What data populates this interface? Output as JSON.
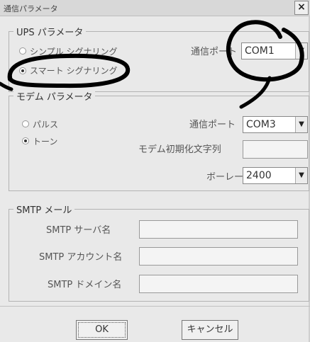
{
  "window": {
    "title": "通信パラメータ",
    "close_label": "×"
  },
  "ups": {
    "legend": "UPS パラメータ",
    "radio_simple": "シンプル シグナリング",
    "radio_smart": "スマート シグナリング",
    "port_label": "通信ポート",
    "port_value": "COM1"
  },
  "modem": {
    "legend": "モデム パラメータ",
    "radio_pulse": "パルス",
    "radio_tone": "トーン",
    "port_label": "通信ポート",
    "port_value": "COM3",
    "init_label": "モデム初期化文字列",
    "init_value": "",
    "baud_label": "ボーレート",
    "baud_value": "2400"
  },
  "smtp": {
    "legend": "SMTP メール",
    "server_label": "SMTP サーバ名",
    "server_value": "",
    "account_label": "SMTP アカウント名",
    "account_value": "",
    "domain_label": "SMTP ドメイン名",
    "domain_value": ""
  },
  "buttons": {
    "ok": "OK",
    "cancel": "キャンセル"
  },
  "annotation_color": "#000000"
}
